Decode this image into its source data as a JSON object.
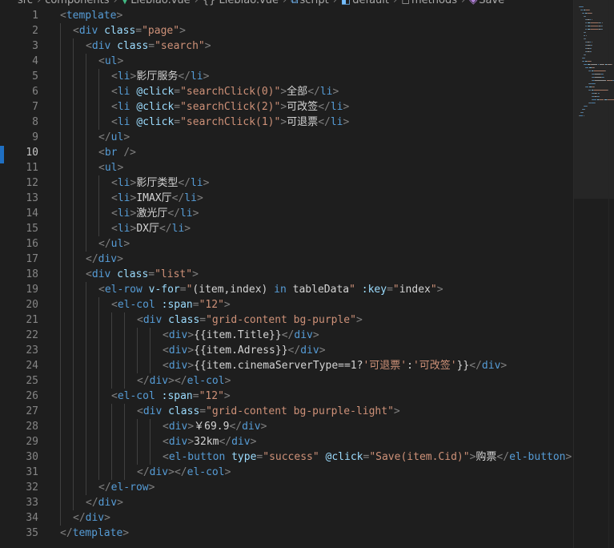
{
  "breadcrumb": {
    "items": [
      "src",
      "components",
      "Liebiao.vue",
      "{} Liebiao.vue",
      "script",
      "default",
      "methods",
      "Save"
    ]
  },
  "editor": {
    "lines": [
      {
        "n": "1",
        "indent": 0,
        "tokens": [
          [
            "t",
            "<"
          ],
          [
            "g",
            "template"
          ],
          [
            "t",
            ">"
          ]
        ]
      },
      {
        "n": "2",
        "indent": 1,
        "tokens": [
          [
            "t",
            "<"
          ],
          [
            "g",
            "div"
          ],
          [
            "s",
            " "
          ],
          [
            "a",
            "class"
          ],
          [
            "t",
            "="
          ],
          [
            "r",
            "\"page\""
          ],
          [
            "t",
            ">"
          ]
        ]
      },
      {
        "n": "3",
        "indent": 2,
        "tokens": [
          [
            "t",
            "<"
          ],
          [
            "g",
            "div"
          ],
          [
            "s",
            " "
          ],
          [
            "a",
            "class"
          ],
          [
            "t",
            "="
          ],
          [
            "r",
            "\"search\""
          ],
          [
            "t",
            ">"
          ]
        ]
      },
      {
        "n": "4",
        "indent": 3,
        "tokens": [
          [
            "t",
            "<"
          ],
          [
            "g",
            "ul"
          ],
          [
            "t",
            ">"
          ]
        ]
      },
      {
        "n": "5",
        "indent": 4,
        "tokens": [
          [
            "t",
            "<"
          ],
          [
            "g",
            "li"
          ],
          [
            "t",
            ">"
          ],
          [
            "x",
            "影厅服务"
          ],
          [
            "t",
            "</"
          ],
          [
            "g",
            "li"
          ],
          [
            "t",
            ">"
          ]
        ]
      },
      {
        "n": "6",
        "indent": 4,
        "tokens": [
          [
            "t",
            "<"
          ],
          [
            "g",
            "li"
          ],
          [
            "s",
            " "
          ],
          [
            "a",
            "@click"
          ],
          [
            "t",
            "="
          ],
          [
            "r",
            "\"searchClick(0)\""
          ],
          [
            "t",
            ">"
          ],
          [
            "x",
            "全部"
          ],
          [
            "t",
            "</"
          ],
          [
            "g",
            "li"
          ],
          [
            "t",
            ">"
          ]
        ]
      },
      {
        "n": "7",
        "indent": 4,
        "tokens": [
          [
            "t",
            "<"
          ],
          [
            "g",
            "li"
          ],
          [
            "s",
            " "
          ],
          [
            "a",
            "@click"
          ],
          [
            "t",
            "="
          ],
          [
            "r",
            "\"searchClick(2)\""
          ],
          [
            "t",
            ">"
          ],
          [
            "x",
            "可改签"
          ],
          [
            "t",
            "</"
          ],
          [
            "g",
            "li"
          ],
          [
            "t",
            ">"
          ]
        ]
      },
      {
        "n": "8",
        "indent": 4,
        "tokens": [
          [
            "t",
            "<"
          ],
          [
            "g",
            "li"
          ],
          [
            "s",
            " "
          ],
          [
            "a",
            "@click"
          ],
          [
            "t",
            "="
          ],
          [
            "r",
            "\"searchClick(1)\""
          ],
          [
            "t",
            ">"
          ],
          [
            "x",
            "可退票"
          ],
          [
            "t",
            "</"
          ],
          [
            "g",
            "li"
          ],
          [
            "t",
            ">"
          ]
        ]
      },
      {
        "n": "9",
        "indent": 3,
        "tokens": [
          [
            "t",
            "</"
          ],
          [
            "g",
            "ul"
          ],
          [
            "t",
            ">"
          ]
        ]
      },
      {
        "n": "10",
        "indent": 3,
        "tokens": [
          [
            "t",
            "<"
          ],
          [
            "g",
            "br"
          ],
          [
            "s",
            " "
          ],
          [
            "t",
            "/>"
          ]
        ]
      },
      {
        "n": "11",
        "indent": 3,
        "tokens": [
          [
            "t",
            "<"
          ],
          [
            "g",
            "ul"
          ],
          [
            "t",
            ">"
          ]
        ]
      },
      {
        "n": "12",
        "indent": 4,
        "tokens": [
          [
            "t",
            "<"
          ],
          [
            "g",
            "li"
          ],
          [
            "t",
            ">"
          ],
          [
            "x",
            "影厅类型"
          ],
          [
            "t",
            "</"
          ],
          [
            "g",
            "li"
          ],
          [
            "t",
            ">"
          ]
        ]
      },
      {
        "n": "13",
        "indent": 4,
        "tokens": [
          [
            "t",
            "<"
          ],
          [
            "g",
            "li"
          ],
          [
            "t",
            ">"
          ],
          [
            "x",
            "IMAX厅"
          ],
          [
            "t",
            "</"
          ],
          [
            "g",
            "li"
          ],
          [
            "t",
            ">"
          ]
        ]
      },
      {
        "n": "14",
        "indent": 4,
        "tokens": [
          [
            "t",
            "<"
          ],
          [
            "g",
            "li"
          ],
          [
            "t",
            ">"
          ],
          [
            "x",
            "激光厅"
          ],
          [
            "t",
            "</"
          ],
          [
            "g",
            "li"
          ],
          [
            "t",
            ">"
          ]
        ]
      },
      {
        "n": "15",
        "indent": 4,
        "tokens": [
          [
            "t",
            "<"
          ],
          [
            "g",
            "li"
          ],
          [
            "t",
            ">"
          ],
          [
            "x",
            "DX厅"
          ],
          [
            "t",
            "</"
          ],
          [
            "g",
            "li"
          ],
          [
            "t",
            ">"
          ]
        ]
      },
      {
        "n": "16",
        "indent": 3,
        "tokens": [
          [
            "t",
            "</"
          ],
          [
            "g",
            "ul"
          ],
          [
            "t",
            ">"
          ]
        ]
      },
      {
        "n": "17",
        "indent": 2,
        "tokens": [
          [
            "t",
            "</"
          ],
          [
            "g",
            "div"
          ],
          [
            "t",
            ">"
          ]
        ]
      },
      {
        "n": "18",
        "indent": 2,
        "tokens": [
          [
            "t",
            "<"
          ],
          [
            "g",
            "div"
          ],
          [
            "s",
            " "
          ],
          [
            "a",
            "class"
          ],
          [
            "t",
            "="
          ],
          [
            "r",
            "\"list\""
          ],
          [
            "t",
            ">"
          ]
        ]
      },
      {
        "n": "19",
        "indent": 3,
        "tokens": [
          [
            "t",
            "<"
          ],
          [
            "g",
            "el-row"
          ],
          [
            "s",
            " "
          ],
          [
            "a",
            "v-for"
          ],
          [
            "t",
            "="
          ],
          [
            "r",
            "\""
          ],
          [
            "x",
            "(item,index)"
          ],
          [
            "s",
            " "
          ],
          [
            "k",
            "in"
          ],
          [
            "s",
            " "
          ],
          [
            "x",
            "tableData"
          ],
          [
            "r",
            "\""
          ],
          [
            "s",
            " "
          ],
          [
            "a",
            ":key"
          ],
          [
            "t",
            "="
          ],
          [
            "r",
            "\""
          ],
          [
            "x",
            "index"
          ],
          [
            "r",
            "\""
          ],
          [
            "t",
            ">"
          ]
        ]
      },
      {
        "n": "20",
        "indent": 4,
        "tokens": [
          [
            "t",
            "<"
          ],
          [
            "g",
            "el-col"
          ],
          [
            "s",
            " "
          ],
          [
            "a",
            ":span"
          ],
          [
            "t",
            "="
          ],
          [
            "r",
            "\"12\""
          ],
          [
            "t",
            ">"
          ]
        ]
      },
      {
        "n": "21",
        "indent": 6,
        "tokens": [
          [
            "t",
            "<"
          ],
          [
            "g",
            "div"
          ],
          [
            "s",
            " "
          ],
          [
            "a",
            "class"
          ],
          [
            "t",
            "="
          ],
          [
            "r",
            "\"grid-content bg-purple\""
          ],
          [
            "t",
            ">"
          ]
        ]
      },
      {
        "n": "22",
        "indent": 8,
        "tokens": [
          [
            "t",
            "<"
          ],
          [
            "g",
            "div"
          ],
          [
            "t",
            ">"
          ],
          [
            "x",
            "{{item.Title}}"
          ],
          [
            "t",
            "</"
          ],
          [
            "g",
            "div"
          ],
          [
            "t",
            ">"
          ]
        ]
      },
      {
        "n": "23",
        "indent": 8,
        "tokens": [
          [
            "t",
            "<"
          ],
          [
            "g",
            "div"
          ],
          [
            "t",
            ">"
          ],
          [
            "x",
            "{{item.Adress}}"
          ],
          [
            "t",
            "</"
          ],
          [
            "g",
            "div"
          ],
          [
            "t",
            ">"
          ]
        ]
      },
      {
        "n": "24",
        "indent": 8,
        "tokens": [
          [
            "t",
            "<"
          ],
          [
            "g",
            "div"
          ],
          [
            "t",
            ">"
          ],
          [
            "x",
            "{{item.cinemaServerType==1?"
          ],
          [
            "r",
            "'可退票'"
          ],
          [
            "x",
            ":"
          ],
          [
            "r",
            "'可改签'"
          ],
          [
            "x",
            "}}"
          ],
          [
            "t",
            "</"
          ],
          [
            "g",
            "div"
          ],
          [
            "t",
            ">"
          ]
        ]
      },
      {
        "n": "25",
        "indent": 6,
        "tokens": [
          [
            "t",
            "</"
          ],
          [
            "g",
            "div"
          ],
          [
            "t",
            "></"
          ],
          [
            "g",
            "el-col"
          ],
          [
            "t",
            ">"
          ]
        ]
      },
      {
        "n": "26",
        "indent": 4,
        "tokens": [
          [
            "t",
            "<"
          ],
          [
            "g",
            "el-col"
          ],
          [
            "s",
            " "
          ],
          [
            "a",
            ":span"
          ],
          [
            "t",
            "="
          ],
          [
            "r",
            "\"12\""
          ],
          [
            "t",
            ">"
          ]
        ]
      },
      {
        "n": "27",
        "indent": 6,
        "tokens": [
          [
            "t",
            "<"
          ],
          [
            "g",
            "div"
          ],
          [
            "s",
            " "
          ],
          [
            "a",
            "class"
          ],
          [
            "t",
            "="
          ],
          [
            "r",
            "\"grid-content bg-purple-light\""
          ],
          [
            "t",
            ">"
          ]
        ]
      },
      {
        "n": "28",
        "indent": 8,
        "tokens": [
          [
            "t",
            "<"
          ],
          [
            "g",
            "div"
          ],
          [
            "t",
            ">"
          ],
          [
            "x",
            "￥69.9"
          ],
          [
            "t",
            "</"
          ],
          [
            "g",
            "div"
          ],
          [
            "t",
            ">"
          ]
        ]
      },
      {
        "n": "29",
        "indent": 8,
        "tokens": [
          [
            "t",
            "<"
          ],
          [
            "g",
            "div"
          ],
          [
            "t",
            ">"
          ],
          [
            "x",
            "32km"
          ],
          [
            "t",
            "</"
          ],
          [
            "g",
            "div"
          ],
          [
            "t",
            ">"
          ]
        ]
      },
      {
        "n": "30",
        "indent": 8,
        "tokens": [
          [
            "t",
            "<"
          ],
          [
            "g",
            "el-button"
          ],
          [
            "s",
            " "
          ],
          [
            "a",
            "type"
          ],
          [
            "t",
            "="
          ],
          [
            "r",
            "\"success\""
          ],
          [
            "s",
            " "
          ],
          [
            "a",
            "@click"
          ],
          [
            "t",
            "="
          ],
          [
            "r",
            "\"Save(item.Cid)\""
          ],
          [
            "t",
            ">"
          ],
          [
            "x",
            "购票"
          ],
          [
            "t",
            "</"
          ],
          [
            "g",
            "el-button"
          ],
          [
            "t",
            ">"
          ]
        ]
      },
      {
        "n": "31",
        "indent": 6,
        "tokens": [
          [
            "t",
            "</"
          ],
          [
            "g",
            "div"
          ],
          [
            "t",
            "></"
          ],
          [
            "g",
            "el-col"
          ],
          [
            "t",
            ">"
          ]
        ]
      },
      {
        "n": "32",
        "indent": 3,
        "tokens": [
          [
            "t",
            "</"
          ],
          [
            "g",
            "el-row"
          ],
          [
            "t",
            ">"
          ]
        ]
      },
      {
        "n": "33",
        "indent": 2,
        "tokens": [
          [
            "t",
            "</"
          ],
          [
            "g",
            "div"
          ],
          [
            "t",
            ">"
          ]
        ]
      },
      {
        "n": "34",
        "indent": 1,
        "tokens": [
          [
            "t",
            "</"
          ],
          [
            "g",
            "div"
          ],
          [
            "t",
            ">"
          ]
        ]
      },
      {
        "n": "35",
        "indent": 0,
        "tokens": [
          [
            "t",
            "</"
          ],
          [
            "g",
            "template"
          ],
          [
            "t",
            ">"
          ]
        ]
      }
    ]
  },
  "colors": {
    "background": "#1e1e1e",
    "tag": "#569cd6",
    "punctuation": "#808080",
    "attribute": "#9cdcfe",
    "string": "#ce9178",
    "text": "#d4d4d4",
    "line_number": "#858585",
    "change_marker": "#1f6fc2"
  }
}
